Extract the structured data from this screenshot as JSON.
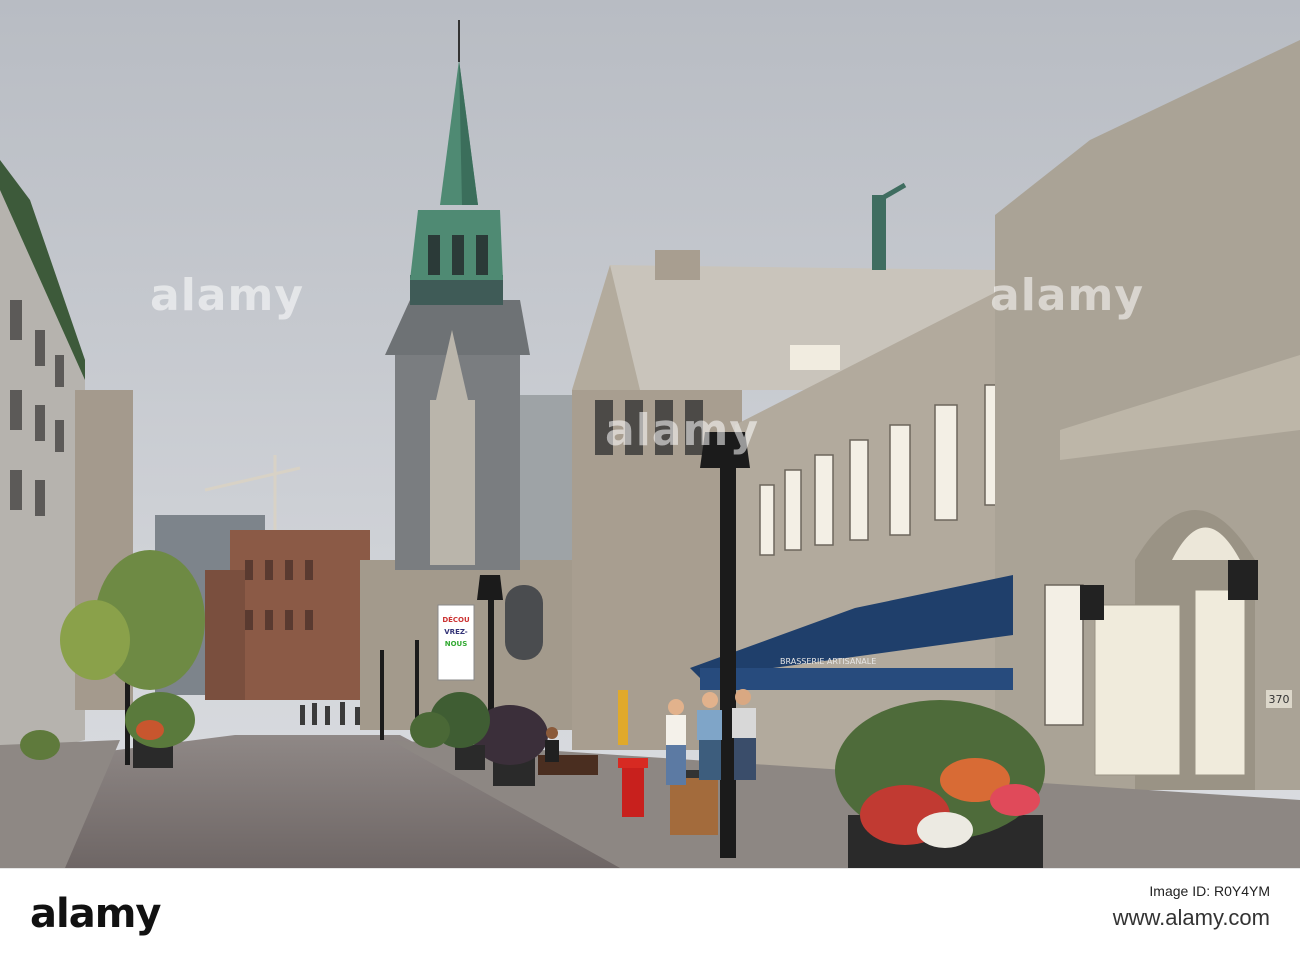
{
  "image": {
    "watermarks": [
      "alamy",
      "alamy",
      "alamy"
    ],
    "signs": {
      "banner": "DÉCOUVREZ-NOUS",
      "awning": "BRASSERIE ARTISANALE",
      "address": "370"
    }
  },
  "footer": {
    "brand": "alamy",
    "image_id": "Image ID: R0Y4YM",
    "url": "www.alamy.com"
  },
  "colors": {
    "sky": "#c9ccd1",
    "stone": "#a59d90",
    "spire": "#4f8a73",
    "awning": "#1f3f6b"
  }
}
